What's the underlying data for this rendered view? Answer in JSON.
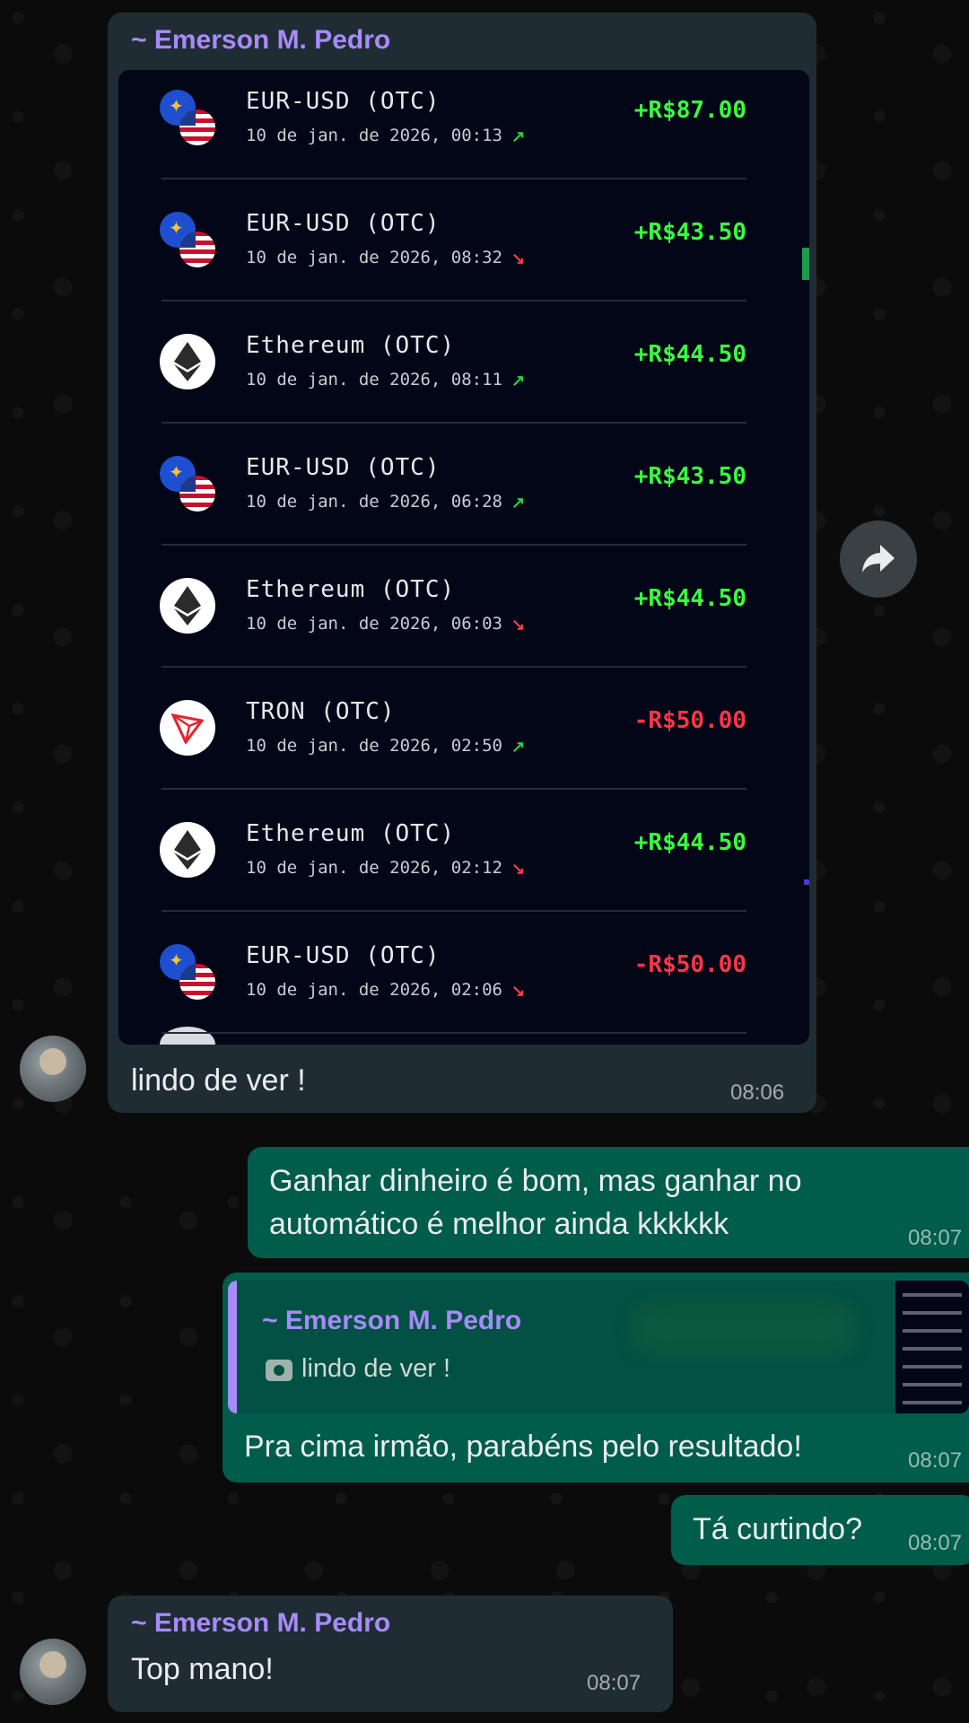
{
  "chat": {
    "messages": [
      {
        "sender": "~ Emerson M. Pedro",
        "text": "lindo de ver !",
        "time": "08:06",
        "trades": [
          {
            "name": "EUR-USD (OTC)",
            "date": "10 de jan. de 2026, 00:13",
            "trend": "up",
            "value": "+R$87.00",
            "icon": "eur-usd-flags-icon"
          },
          {
            "name": "EUR-USD (OTC)",
            "date": "10 de jan. de 2026, 08:32",
            "trend": "down",
            "value": "+R$43.50",
            "icon": "eur-usd-flags-icon"
          },
          {
            "name": "Ethereum (OTC)",
            "date": "10 de jan. de 2026, 08:11",
            "trend": "up",
            "value": "+R$44.50",
            "icon": "ethereum-icon"
          },
          {
            "name": "EUR-USD (OTC)",
            "date": "10 de jan. de 2026, 06:28",
            "trend": "up",
            "value": "+R$43.50",
            "icon": "eur-usd-flags-icon"
          },
          {
            "name": "Ethereum (OTC)",
            "date": "10 de jan. de 2026, 06:03",
            "trend": "down",
            "value": "+R$44.50",
            "icon": "ethereum-icon"
          },
          {
            "name": "TRON (OTC)",
            "date": "10 de jan. de 2026, 02:50",
            "trend": "up",
            "value": "-R$50.00",
            "icon": "tron-icon"
          },
          {
            "name": "Ethereum (OTC)",
            "date": "10 de jan. de 2026, 02:12",
            "trend": "down",
            "value": "+R$44.50",
            "icon": "ethereum-icon"
          },
          {
            "name": "EUR-USD (OTC)",
            "date": "10 de jan. de 2026, 02:06",
            "trend": "down",
            "value": "-R$50.00",
            "icon": "eur-usd-flags-icon"
          }
        ]
      },
      {
        "text": "Ganhar dinheiro é bom, mas ganhar no automático é melhor ainda kkkkkk",
        "time": "08:07"
      },
      {
        "quote_sender": "~ Emerson M. Pedro",
        "quote_text": "lindo de ver !",
        "text": "Pra cima irmão, parabéns pelo resultado!",
        "time": "08:07"
      },
      {
        "text": "Tá curtindo?",
        "time": "08:07"
      },
      {
        "sender": "~ Emerson M. Pedro",
        "text": "Top mano!",
        "time": "08:07"
      }
    ]
  },
  "colors": {
    "incoming_bubble": "#202c33",
    "outgoing_bubble": "#005c4b",
    "sender_name": "#a78bfa",
    "positive_value": "#39ff3d",
    "negative_value": "#ff3548"
  }
}
